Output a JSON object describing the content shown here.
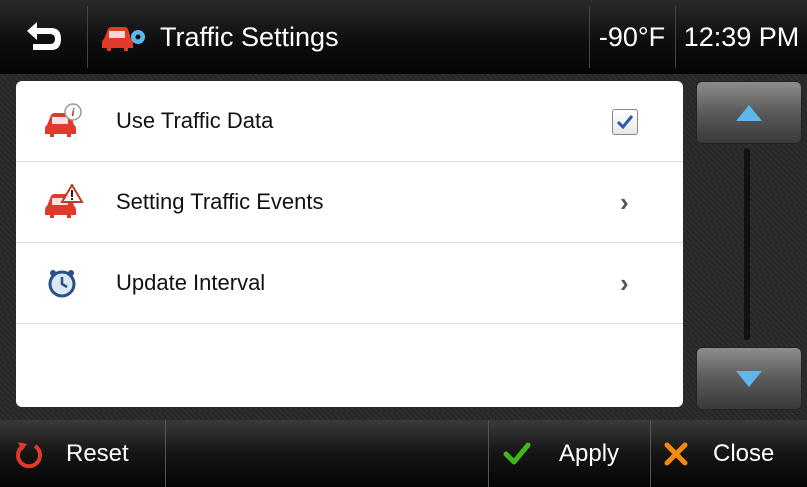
{
  "header": {
    "title": "Traffic Settings",
    "temperature": "-90°F",
    "time": "12:39 PM",
    "back_icon": "back-arrow-icon",
    "title_icon": "traffic-settings-icon"
  },
  "list": {
    "items": [
      {
        "label": "Use Traffic Data",
        "icon": "traffic-info-icon",
        "control": "checkbox",
        "checked": true
      },
      {
        "label": "Setting Traffic Events",
        "icon": "traffic-warning-icon",
        "control": "chevron",
        "chevron": "›"
      },
      {
        "label": "Update Interval",
        "icon": "clock-icon",
        "control": "chevron",
        "chevron": "›"
      }
    ]
  },
  "footer": {
    "reset_label": "Reset",
    "apply_label": "Apply",
    "close_label": "Close"
  },
  "colors": {
    "accent_red": "#e03a2a",
    "apply_green": "#3fb51e",
    "close_orange": "#f58a12",
    "scroll_arrow": "#5fb6ea",
    "check_blue": "#2a5aa8"
  }
}
